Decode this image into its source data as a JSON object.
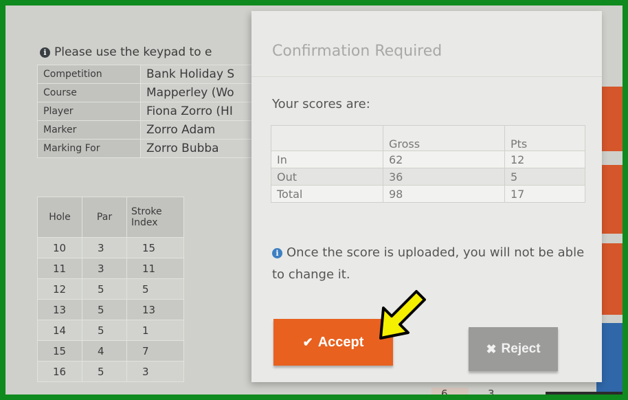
{
  "info_text": "Please use the keypad to e",
  "details": [
    {
      "label": "Competition",
      "value": "Bank Holiday S"
    },
    {
      "label": "Course",
      "value": "Mapperley (Wo"
    },
    {
      "label": "Player",
      "value": "Fiona Zorro (HI"
    },
    {
      "label": "Marker",
      "value": "Zorro Adam"
    },
    {
      "label": "Marking For",
      "value": "Zorro Bubba"
    }
  ],
  "holes_table": {
    "headers": [
      "Hole",
      "Par",
      "Stroke Index"
    ],
    "rows": [
      [
        "10",
        "3",
        "15"
      ],
      [
        "11",
        "3",
        "11"
      ],
      [
        "12",
        "5",
        "5"
      ],
      [
        "13",
        "5",
        "13"
      ],
      [
        "14",
        "5",
        "1"
      ],
      [
        "15",
        "4",
        "7"
      ],
      [
        "16",
        "5",
        "3"
      ]
    ]
  },
  "bottom_partial": [
    "6",
    "3"
  ],
  "modal": {
    "title": "Confirmation Required",
    "scores_label": "Your scores are:",
    "scores_headers": [
      "",
      "Gross",
      "Pts"
    ],
    "scores_rows": [
      [
        "In",
        "62",
        "12"
      ],
      [
        "Out",
        "36",
        "5"
      ],
      [
        "Total",
        "98",
        "17"
      ]
    ],
    "note": "Once the score is uploaded, you will not be able to change it.",
    "accept_label": "Accept",
    "reject_label": "Reject"
  },
  "colors": {
    "frame": "#0f8a1e",
    "accept": "#e8611f",
    "reject": "#9b9c99",
    "arrow": "#f5ef00"
  },
  "icons": [
    "info-icon",
    "check-icon",
    "x-icon",
    "arrow-pointer-icon"
  ]
}
